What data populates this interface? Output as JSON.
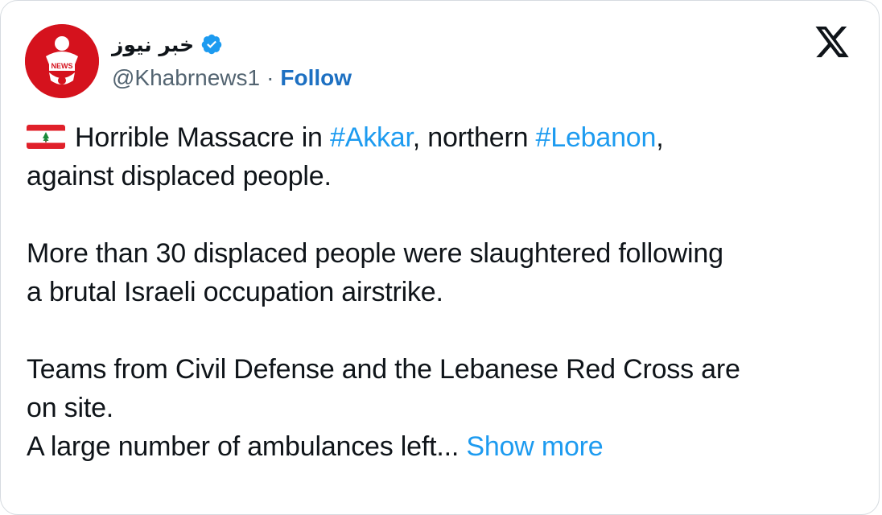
{
  "tweet": {
    "display_name": "خبر نيوز",
    "handle": "@Khabrnews1",
    "separator": "·",
    "follow_label": "Follow",
    "avatar_badge_text": "NEWS",
    "flag_icon": "lebanon-flag-icon",
    "brand_logo": "x-logo",
    "colors": {
      "link_blue": "#1d9bf0",
      "follow_blue": "#1d70c2",
      "avatar_red": "#d5121d",
      "verified_blue": "#1d9bf0"
    },
    "body": {
      "p1": {
        "text1": "Horrible Massacre in ",
        "hashtag1": "#Akkar",
        "text2": ", northern ",
        "hashtag2": "#Lebanon",
        "text3": ",",
        "text4": "against displaced people."
      },
      "p2": {
        "line1": "More than 30 displaced people were slaughtered following",
        "line2": "a brutal Israeli occupation airstrike."
      },
      "p3": {
        "line1": "Teams from Civil Defense and the Lebanese Red Cross are",
        "line2": "on site.",
        "line3": "A large number of ambulances left...",
        "show_more": "Show more"
      }
    }
  }
}
